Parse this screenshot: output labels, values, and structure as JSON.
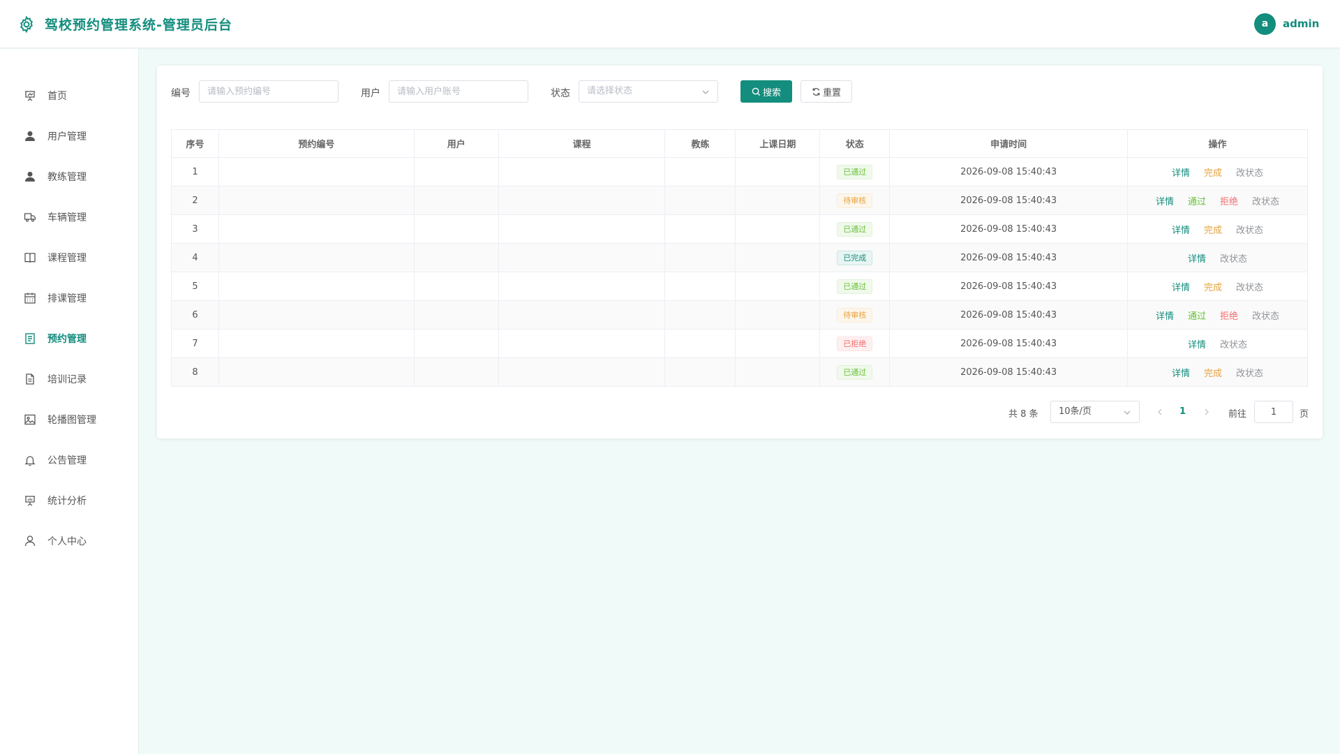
{
  "header": {
    "title": "驾校预约管理系统-管理员后台",
    "avatar_letter": "a",
    "username": "admin"
  },
  "sidebar": {
    "items": [
      {
        "label": "首页",
        "icon": "presentation-icon"
      },
      {
        "label": "用户管理",
        "icon": "user-icon"
      },
      {
        "label": "教练管理",
        "icon": "user-icon"
      },
      {
        "label": "车辆管理",
        "icon": "truck-icon"
      },
      {
        "label": "课程管理",
        "icon": "book-icon"
      },
      {
        "label": "排课管理",
        "icon": "calendar-icon"
      },
      {
        "label": "预约管理",
        "icon": "document-icon",
        "active": true
      },
      {
        "label": "培训记录",
        "icon": "file-icon"
      },
      {
        "label": "轮播图管理",
        "icon": "picture-icon"
      },
      {
        "label": "公告管理",
        "icon": "bell-icon"
      },
      {
        "label": "统计分析",
        "icon": "chart-board-icon"
      },
      {
        "label": "个人中心",
        "icon": "user-outline-icon"
      }
    ]
  },
  "search": {
    "code_label": "编号",
    "code_placeholder": "请输入预约编号",
    "user_label": "用户",
    "user_placeholder": "请输入用户账号",
    "status_label": "状态",
    "status_placeholder": "请选择状态",
    "search_button": "搜索",
    "reset_button": "重置"
  },
  "table": {
    "columns": [
      "序号",
      "预约编号",
      "用户",
      "课程",
      "教练",
      "上课日期",
      "状态",
      "申请时间",
      "操作"
    ],
    "rows": [
      {
        "index": "1",
        "code": "",
        "user": "",
        "course": "",
        "coach": "",
        "date": "",
        "status": "已通过",
        "status_type": "approved",
        "time": "2026-09-08 15:40:43",
        "actions": [
          "详情",
          "完成",
          "改状态"
        ]
      },
      {
        "index": "2",
        "code": "",
        "user": "",
        "course": "",
        "coach": "",
        "date": "",
        "status": "待审核",
        "status_type": "pending",
        "time": "2026-09-08 15:40:43",
        "actions": [
          "详情",
          "通过",
          "拒绝",
          "改状态"
        ]
      },
      {
        "index": "3",
        "code": "",
        "user": "",
        "course": "",
        "coach": "",
        "date": "",
        "status": "已通过",
        "status_type": "approved",
        "time": "2026-09-08 15:40:43",
        "actions": [
          "详情",
          "完成",
          "改状态"
        ]
      },
      {
        "index": "4",
        "code": "",
        "user": "",
        "course": "",
        "coach": "",
        "date": "",
        "status": "已完成",
        "status_type": "completed",
        "time": "2026-09-08 15:40:43",
        "actions": [
          "详情",
          "改状态"
        ]
      },
      {
        "index": "5",
        "code": "",
        "user": "",
        "course": "",
        "coach": "",
        "date": "",
        "status": "已通过",
        "status_type": "approved",
        "time": "2026-09-08 15:40:43",
        "actions": [
          "详情",
          "完成",
          "改状态"
        ]
      },
      {
        "index": "6",
        "code": "",
        "user": "",
        "course": "",
        "coach": "",
        "date": "",
        "status": "待审核",
        "status_type": "pending",
        "time": "2026-09-08 15:40:43",
        "actions": [
          "详情",
          "通过",
          "拒绝",
          "改状态"
        ]
      },
      {
        "index": "7",
        "code": "",
        "user": "",
        "course": "",
        "coach": "",
        "date": "",
        "status": "已拒绝",
        "status_type": "rejected",
        "time": "2026-09-08 15:40:43",
        "actions": [
          "详情",
          "改状态"
        ]
      },
      {
        "index": "8",
        "code": "",
        "user": "",
        "course": "",
        "coach": "",
        "date": "",
        "status": "已通过",
        "status_type": "approved",
        "time": "2026-09-08 15:40:43",
        "actions": [
          "详情",
          "完成",
          "改状态"
        ]
      }
    ]
  },
  "pagination": {
    "total_text": "共 8 条",
    "page_size": "10条/页",
    "current_page": "1",
    "goto_label": "前往",
    "goto_value": "1",
    "page_suffix": "页"
  },
  "colors": {
    "accent": "#138d7d",
    "approved": "#67c23a",
    "pending": "#e6a23c",
    "rejected": "#f56c6c",
    "muted": "#909399"
  }
}
